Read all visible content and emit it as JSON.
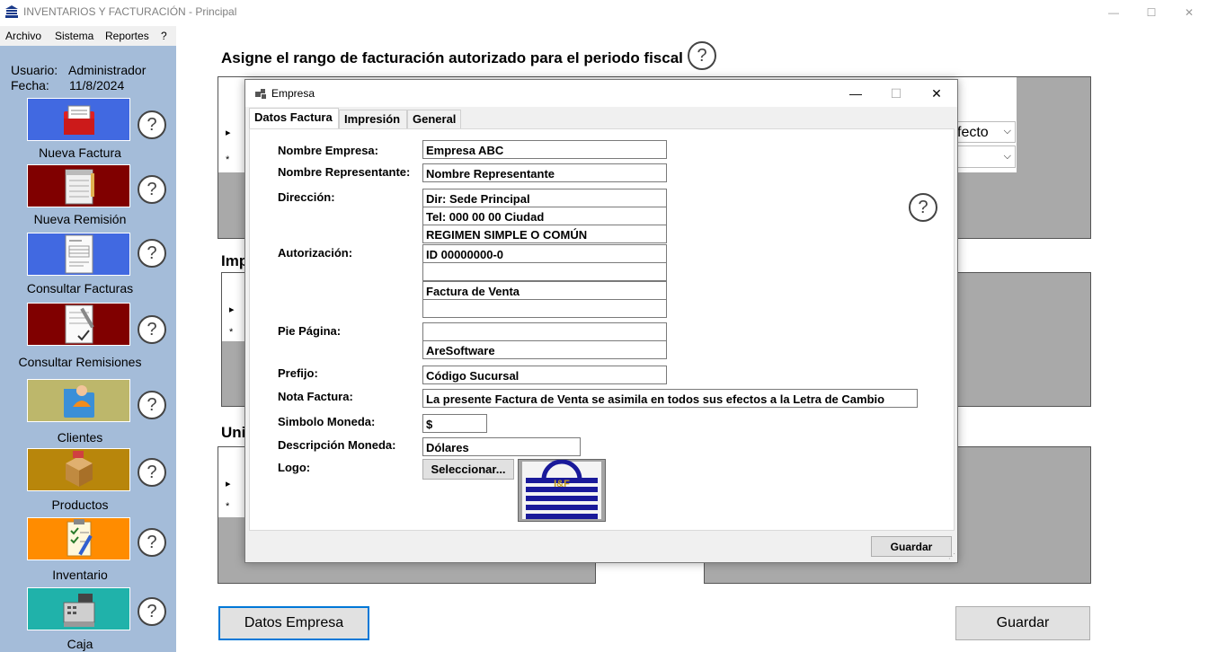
{
  "app": {
    "title": "INVENTARIOS Y FACTURACIÓN - Principal",
    "window_controls": [
      "—",
      "☐",
      "✕"
    ]
  },
  "menu": [
    "Archivo",
    "Sistema",
    "Reportes",
    "?"
  ],
  "sidebar": {
    "user_label": "Usuario:",
    "user_value": "Administrador",
    "date_label": "Fecha:",
    "date_value": "11/8/2024",
    "items": [
      {
        "label": "Nueva Factura",
        "icon": "invoice-folder-icon",
        "color": "#4169e1"
      },
      {
        "label": "Nueva Remisión",
        "icon": "notepad-icon",
        "color": "#800000"
      },
      {
        "label": "Consultar Facturas",
        "icon": "document-list-icon",
        "color": "#4169e1"
      },
      {
        "label": "Consultar Remisiones",
        "icon": "signed-document-icon",
        "color": "#800000"
      },
      {
        "label": "Clientes",
        "icon": "client-folder-icon",
        "color": "#bdb76b"
      },
      {
        "label": "Productos",
        "icon": "box-icon",
        "color": "#b8860b"
      },
      {
        "label": "Inventario",
        "icon": "clipboard-icon",
        "color": "#ff8c00"
      },
      {
        "label": "Caja",
        "icon": "cash-register-icon",
        "color": "#20b2aa"
      }
    ],
    "help_glyph": "?"
  },
  "main": {
    "title": "Asigne el rango de facturación autorizado para el periodo fiscal",
    "section2_label": "Imp",
    "section3_label": "Uni",
    "efecto_value": "fecto",
    "row_arrow": "▸",
    "row_new": "*",
    "datos_empresa_btn": "Datos Empresa",
    "guardar_btn": "Guardar"
  },
  "dialog": {
    "title": "Empresa",
    "controls": [
      "—",
      "☐",
      "✕"
    ],
    "tabs": [
      "Datos Factura",
      "Impresión",
      "General"
    ],
    "fields": {
      "nombre_empresa_label": "Nombre Empresa:",
      "nombre_empresa": "Empresa ABC",
      "nombre_representante_label": "Nombre Representante:",
      "nombre_representante": "Nombre Representante",
      "direccion_label": "Dirección:",
      "direccion": [
        "Dir: Sede Principal",
        "Tel: 000 00 00 Ciudad",
        "REGIMEN SIMPLE O COMÚN"
      ],
      "autorizacion_label": "Autorización:",
      "autorizacion": [
        "ID 00000000-0",
        "",
        "Factura de Venta",
        ""
      ],
      "pie_pagina_label": "Pie Página:",
      "pie_pagina": [
        "",
        "AreSoftware"
      ],
      "prefijo_label": "Prefijo:",
      "prefijo": "Código Sucursal",
      "nota_factura_label": "Nota Factura:",
      "nota_factura": "La presente Factura de Venta se asimila en todos sus efectos a la Letra de Cambio",
      "simbolo_moneda_label": "Simbolo Moneda:",
      "simbolo_moneda": "$",
      "descripcion_moneda_label": "Descripción Moneda:",
      "descripcion_moneda": "Dólares",
      "logo_label": "Logo:",
      "seleccionar_btn": "Seleccionar...",
      "logo_text": "I&F"
    },
    "guardar_btn": "Guardar"
  }
}
